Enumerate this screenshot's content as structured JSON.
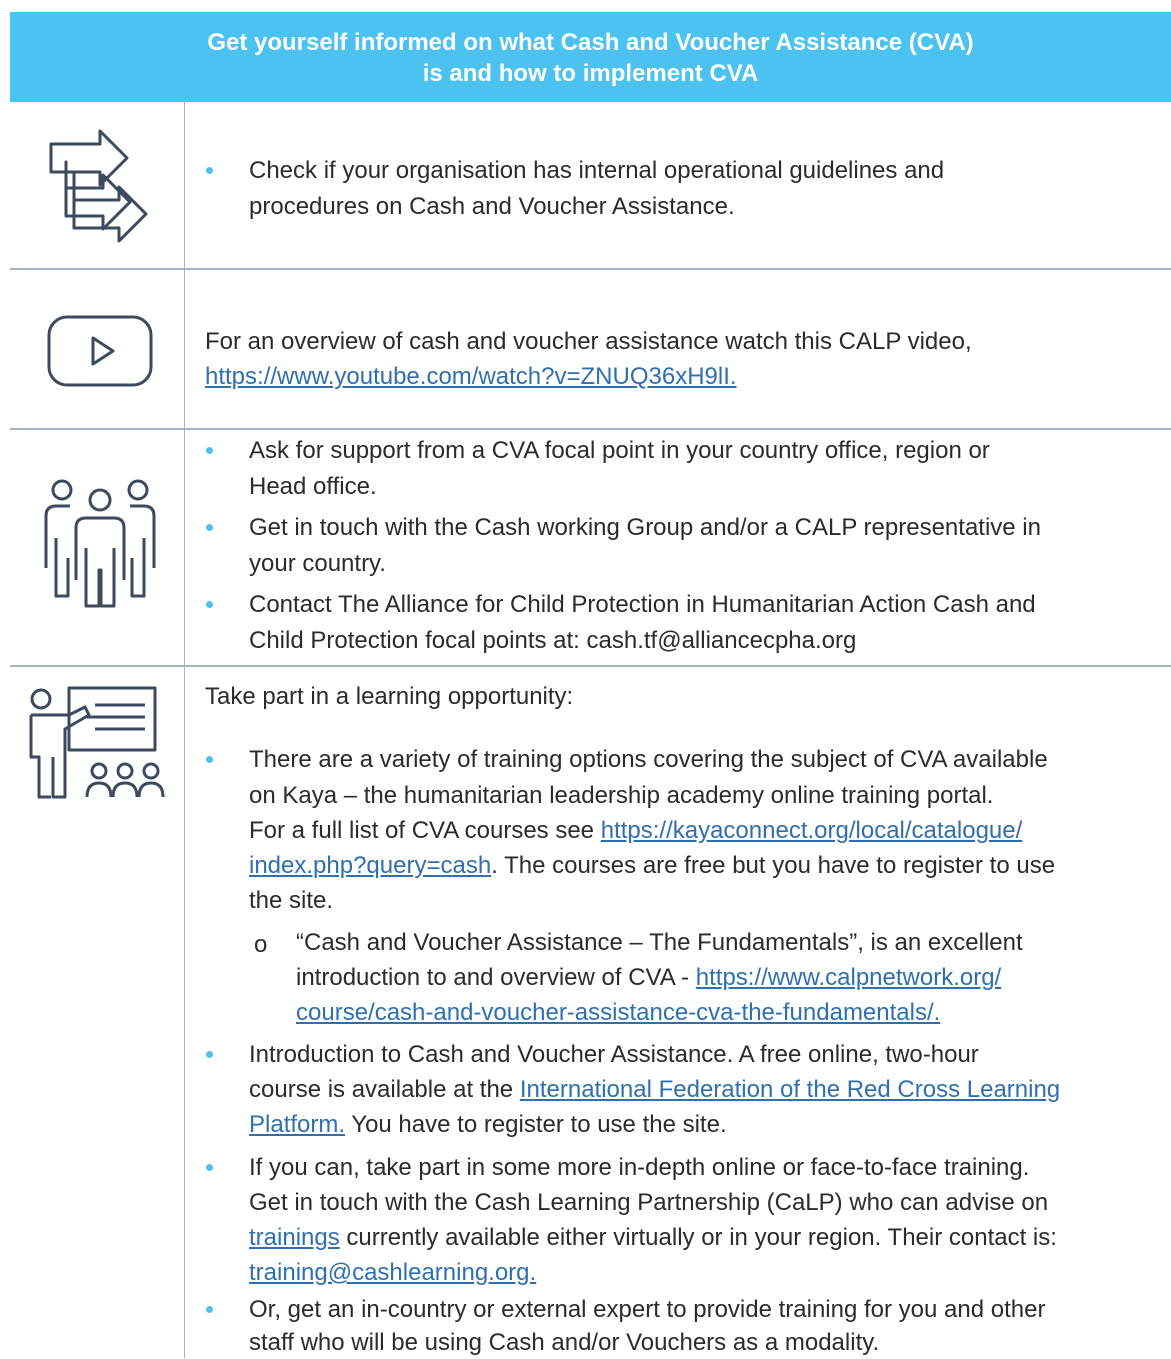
{
  "header": {
    "line1": "Get yourself informed on what Cash and Voucher Assistance (CVA)",
    "line2": "is and how to implement CVA"
  },
  "colors": {
    "accent": "#4bc2f0",
    "link": "#2f6fb0",
    "border": "#a7b3bf",
    "icon": "#3b4a5c"
  },
  "icons": [
    "arrows-icon",
    "video-play-icon",
    "people-group-icon",
    "presentation-icon"
  ],
  "row1": {
    "b1_l1": "Check if your organisation has internal operational guidelines and",
    "b1_l2": "procedures on Cash and Voucher Assistance."
  },
  "row2": {
    "l1": "For an overview of cash and voucher assistance watch this CALP video,",
    "link": "https://www.youtube.com/watch?v=ZNUQ36xH9lI."
  },
  "row3": {
    "b1_l1": "Ask for support from a CVA focal point in your country office, region or",
    "b1_l2": "Head office.",
    "b2_l1": "Get in touch with the Cash working Group and/or a CALP representative in",
    "b2_l2": "your country.",
    "b3_l1": "Contact The Alliance for Child Protection in Humanitarian Action Cash and",
    "b3_l2": "Child Protection focal points at: cash.tf@alliancecpha.org"
  },
  "row4": {
    "intro": "Take part in a learning opportunity:",
    "b1_l1": "There are a variety of training options covering the subject of CVA available",
    "b1_l2": "on Kaya – the humanitarian leadership academy online training portal.",
    "b1_l3": "For a full list of CVA courses see ",
    "b1_link1": "https://kayaconnect.org/local/catalogue/",
    "b1_link2": "index.php?query=cash",
    "b1_l4_rest": ". The courses are free but you have to register to use",
    "b1_l5": "the site.",
    "sub_marker": "o",
    "sub_l1": "“Cash and Voucher Assistance – The Fundamentals”, is an excellent",
    "sub_l2": "introduction to and overview of CVA - ",
    "sub_link1": "https://www.calpnetwork.org/",
    "sub_link2": "course/cash-and-voucher-assistance-cva-the-fundamentals/.",
    "b2_l1": "Introduction to Cash and Voucher Assistance. A free online, two-hour",
    "b2_l2": "course is available at the ",
    "b2_link1": "International Federation of the Red Cross Learning",
    "b2_link2": "Platform.",
    "b2_l3_rest": " You have to register to use the site.",
    "b3_l1": "If you can, take part in some more in-depth online or face-to-face training.",
    "b3_l2": "Get in touch with the Cash Learning Partnership (CaLP) who can advise on",
    "b3_link1": "trainings",
    "b3_l3_rest": " currently available either virtually or in your region. Their contact is:",
    "b3_link2": "training@cashlearning.org. ",
    "b4_l1": "Or, get an in-country or external expert to provide training for you and other",
    "b4_l2": "staff who will be using Cash and/or Vouchers as a modality."
  }
}
